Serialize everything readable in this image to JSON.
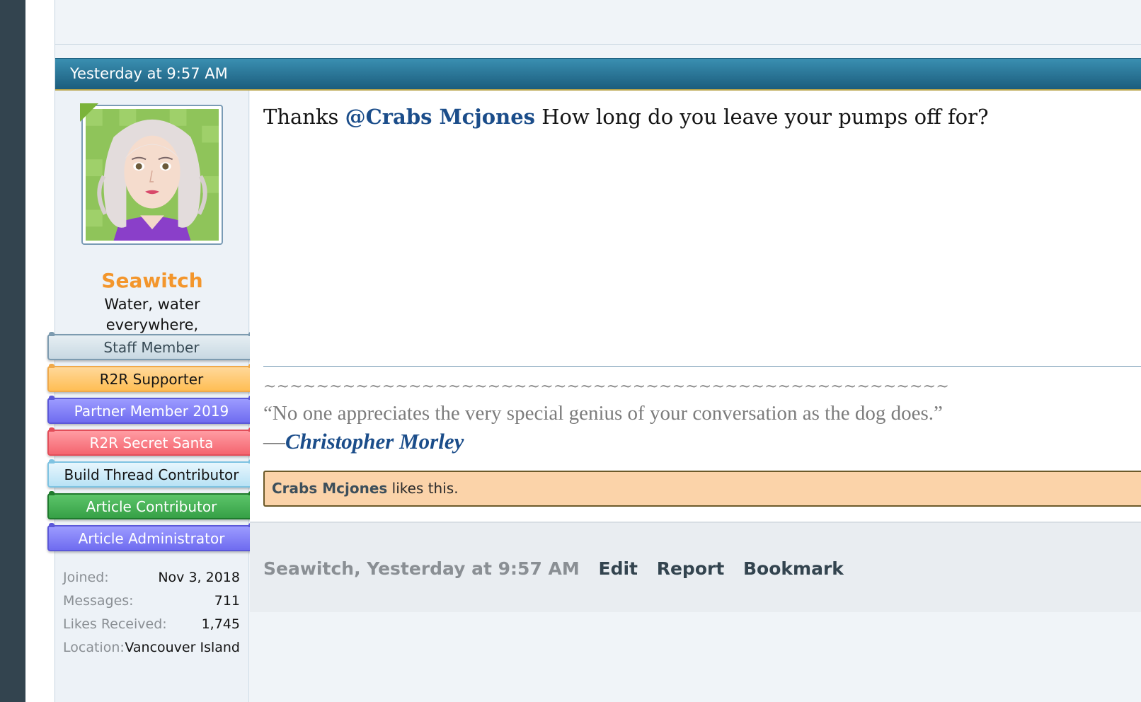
{
  "post": {
    "timestamp": "Yesterday at 9:57 AM"
  },
  "user": {
    "name": "Seawitch",
    "title": "Water, water everywhere,",
    "banners": [
      "Staff Member",
      "R2R Supporter",
      "Partner Member 2019",
      "R2R Secret Santa",
      "Build Thread Contributor",
      "Article Contributor",
      "Article Administrator"
    ],
    "stats": [
      {
        "label": "Joined:",
        "value": "Nov 3, 2018"
      },
      {
        "label": "Messages:",
        "value": "711"
      },
      {
        "label": "Likes Received:",
        "value": "1,745"
      },
      {
        "label": "Location:",
        "value": "Vancouver Island"
      }
    ]
  },
  "message": {
    "prefix": "Thanks ",
    "mention": "@Crabs Mcjones",
    "suffix": " How long do you leave your pumps off for?"
  },
  "signature": {
    "tildes": "~~~~~~~~~~~~~~~~~~~~~~~~~~~~~~~~~~~~~~~~~~~~~~~~~~~~",
    "quote": "“No one appreciates the very special genius of your conversation as the dog does.”",
    "dash": "—",
    "author": "Christopher Morley"
  },
  "likes": {
    "name": "Crabs Mcjones",
    "text": " likes this."
  },
  "footer": {
    "meta": "Seawitch, Yesterday at 9:57 AM",
    "edit": "Edit",
    "report": "Report",
    "bookmark": "Bookmark"
  },
  "colors": {
    "username": "#f3962c",
    "header_bar": "#2a7596",
    "mention": "#1b4d8a",
    "likes_bg": "#fbd3a9"
  }
}
